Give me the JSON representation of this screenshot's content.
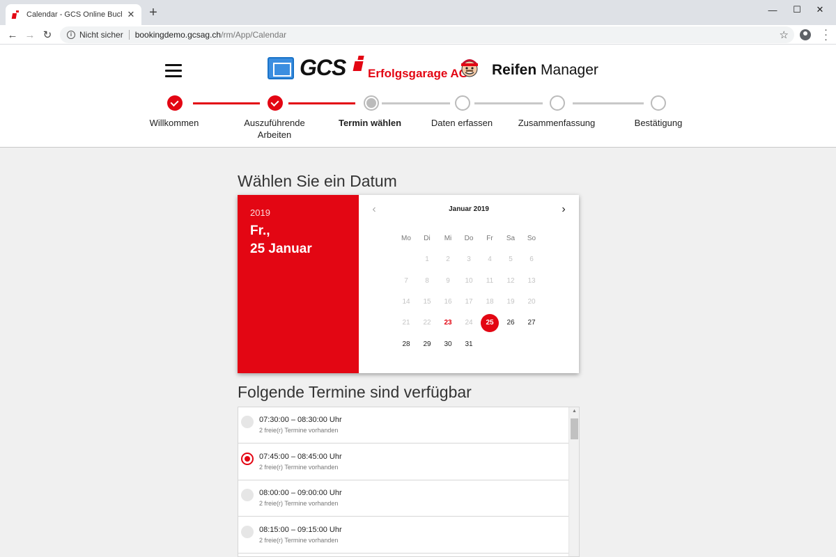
{
  "browser": {
    "tab_title": "Calendar - GCS Online Buchungs",
    "security_label": "Nicht sicher",
    "url_host": "bookingdemo.gcsag.ch",
    "url_path": "/rm/App/Calendar"
  },
  "header": {
    "logo_text": "GCS",
    "company": "Erfolgsgarage AG",
    "app_title_bold": "Reifen",
    "app_title_rest": "Manager"
  },
  "steps": [
    {
      "label": "Willkommen",
      "state": "done"
    },
    {
      "label": "Auszuführende Arbeiten",
      "state": "done"
    },
    {
      "label": "Termin wählen",
      "state": "current"
    },
    {
      "label": "Daten erfassen",
      "state": "todo"
    },
    {
      "label": "Zusammenfassung",
      "state": "todo"
    },
    {
      "label": "Bestätigung",
      "state": "todo"
    }
  ],
  "date_section": {
    "title": "Wählen Sie ein Datum"
  },
  "calendar": {
    "selected_year": "2019",
    "selected_weekday": "Fr.,",
    "selected_date": "25 Januar",
    "month_label": "Januar 2019",
    "weekdays": [
      "Mo",
      "Di",
      "Mi",
      "Do",
      "Fr",
      "Sa",
      "So"
    ],
    "weeks": [
      [
        null,
        "1",
        "2",
        "3",
        "4",
        "5",
        "6"
      ],
      [
        "7",
        "8",
        "9",
        "10",
        "11",
        "12",
        "13"
      ],
      [
        "14",
        "15",
        "16",
        "17",
        "18",
        "19",
        "20"
      ],
      [
        "21",
        "22",
        "23",
        "24",
        "25",
        "26",
        "27"
      ],
      [
        "28",
        "29",
        "30",
        "31",
        null,
        null,
        null
      ]
    ],
    "today": "23",
    "selected": "25",
    "enabled_days": [
      "25",
      "26",
      "27",
      "28",
      "29",
      "30",
      "31"
    ]
  },
  "slots_section": {
    "title": "Folgende Termine sind verfügbar"
  },
  "slots": [
    {
      "time": "07:30:00 – 08:30:00 Uhr",
      "availability": "2 freie(r) Termine vorhanden",
      "selected": false
    },
    {
      "time": "07:45:00 – 08:45:00 Uhr",
      "availability": "2 freie(r) Termine vorhanden",
      "selected": true
    },
    {
      "time": "08:00:00 – 09:00:00 Uhr",
      "availability": "2 freie(r) Termine vorhanden",
      "selected": false
    },
    {
      "time": "08:15:00 – 09:15:00 Uhr",
      "availability": "2 freie(r) Termine vorhanden",
      "selected": false
    }
  ],
  "colors": {
    "accent": "#e30613",
    "logo_blue": "#1a73c8"
  }
}
